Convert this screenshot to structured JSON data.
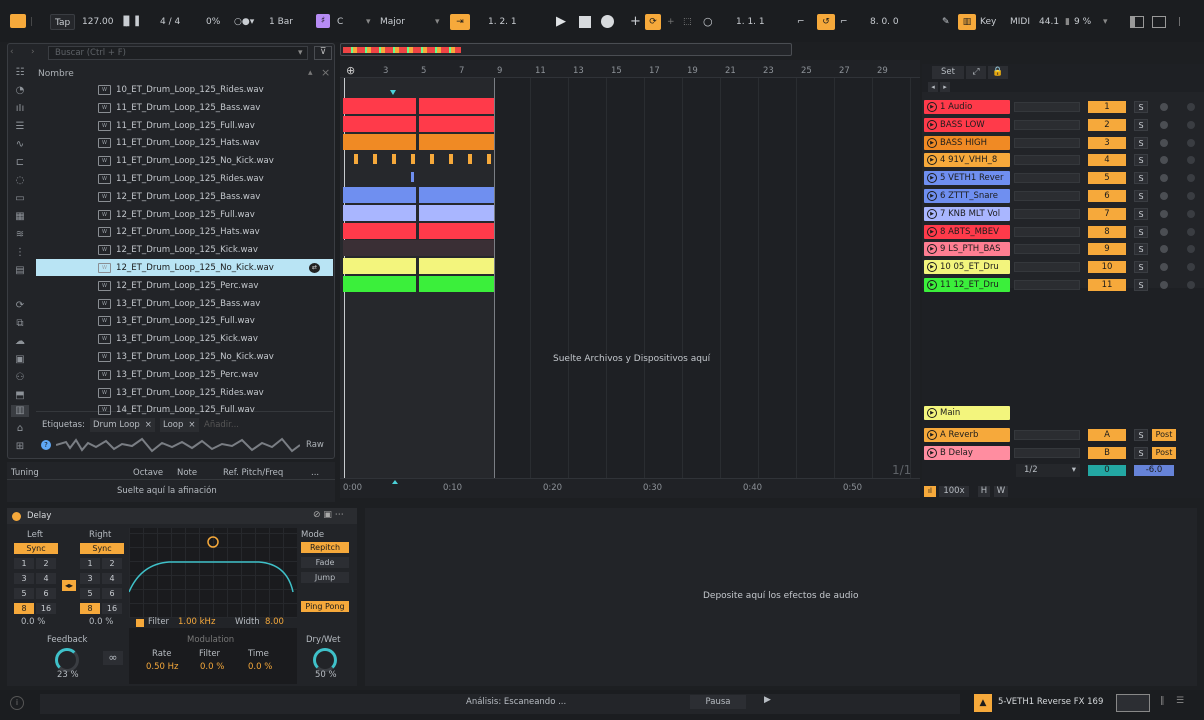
{
  "toolbar": {
    "tap": "Tap",
    "tempo": "127.00",
    "signature": "4 / 4",
    "swing": "0%",
    "quantize": "1 Bar",
    "key_letter": "C",
    "scale": "Major",
    "position": "1.   2.   1",
    "loop_start": "1.   1.   1",
    "loop_len": "8.   0.   0",
    "key_label": "Key",
    "midi_label": "MIDI",
    "sample_rate": "44.1",
    "cpu": "9 %"
  },
  "browser": {
    "search_placeholder": "Buscar (Ctrl + F)",
    "column_header": "Nombre",
    "files": [
      "10_ET_Drum_Loop_125_Rides.wav",
      "11_ET_Drum_Loop_125_Bass.wav",
      "11_ET_Drum_Loop_125_Full.wav",
      "11_ET_Drum_Loop_125_Hats.wav",
      "11_ET_Drum_Loop_125_No_Kick.wav",
      "11_ET_Drum_Loop_125_Rides.wav",
      "12_ET_Drum_Loop_125_Bass.wav",
      "12_ET_Drum_Loop_125_Full.wav",
      "12_ET_Drum_Loop_125_Hats.wav",
      "12_ET_Drum_Loop_125_Kick.wav",
      "12_ET_Drum_Loop_125_No_Kick.wav",
      "12_ET_Drum_Loop_125_Perc.wav",
      "13_ET_Drum_Loop_125_Bass.wav",
      "13_ET_Drum_Loop_125_Full.wav",
      "13_ET_Drum_Loop_125_Kick.wav",
      "13_ET_Drum_Loop_125_No_Kick.wav",
      "13_ET_Drum_Loop_125_Perc.wav",
      "13_ET_Drum_Loop_125_Rides.wav",
      "14_ET_Drum_Loop_125_Full.wav"
    ],
    "selected_index": 10,
    "tags_label": "Etiquetas:",
    "tags": [
      "Drum Loop",
      "Loop"
    ],
    "tag_add": "Añadir...",
    "raw": "Raw"
  },
  "tuning": {
    "title": "Tuning",
    "octave": "Octave",
    "note": "Note",
    "ref": "Ref. Pitch/Freq",
    "more": "...",
    "drop": "Suelte aquí la afinación"
  },
  "arrangement": {
    "ruler": [
      "3",
      "5",
      "7",
      "9",
      "11",
      "13",
      "15",
      "17",
      "19",
      "21",
      "23",
      "25",
      "27",
      "29"
    ],
    "drop_text": "Suelte Archivos y Dispositivos aquí",
    "time_ruler": [
      "0:00",
      "0:10",
      "0:20",
      "0:30",
      "0:40",
      "0:50"
    ],
    "page": "1/1"
  },
  "mixer": {
    "set": "Set",
    "tracks": [
      {
        "name": "1 Audio",
        "num": "1",
        "color": "#ff3a4a"
      },
      {
        "name": "BASS LOW",
        "num": "2",
        "color": "#ff3a4a"
      },
      {
        "name": "BASS HIGH",
        "num": "3",
        "color": "#f08a24"
      },
      {
        "name": "4 91V_VHH_8",
        "num": "4",
        "color": "#f6a93b"
      },
      {
        "name": "5 VETH1 Rever",
        "num": "5",
        "color": "#6f8ff0"
      },
      {
        "name": "6 ZTTT_Snare",
        "num": "6",
        "color": "#6f8ff0"
      },
      {
        "name": "7 KNB MLT Vol",
        "num": "7",
        "color": "#a9b6ff"
      },
      {
        "name": "8 ABTS_MBEV",
        "num": "8",
        "color": "#ff3a4a"
      },
      {
        "name": "9 LS_PTH_BAS",
        "num": "9",
        "color": "#ff7e92"
      },
      {
        "name": "10 05_ET_Dru",
        "num": "10",
        "color": "#f3f57d"
      },
      {
        "name": "11 12_ET_Dru",
        "num": "11",
        "color": "#3bef3b"
      }
    ],
    "returns": [
      {
        "name": "A Reverb",
        "num": "A",
        "color": "#f6a93b"
      },
      {
        "name": "B Delay",
        "num": "B",
        "color": "#ff8da0"
      }
    ],
    "main": "Main",
    "main_select": "1/2",
    "main_num": "0",
    "main_vol": "-6.0",
    "post": "Post",
    "s": "S",
    "zoom": "100x",
    "h": "H",
    "w": "W"
  },
  "delay": {
    "title": "Delay",
    "left": "Left",
    "right": "Right",
    "sync": "Sync",
    "grid": [
      "1",
      "2",
      "3",
      "4",
      "5",
      "6",
      "8",
      "16"
    ],
    "left_pct": "0.0 %",
    "right_pct": "0.0 %",
    "mode": "Mode",
    "modes": [
      "Repitch",
      "Fade",
      "Jump"
    ],
    "ping_pong": "Ping Pong",
    "filter_label": "Filter",
    "filter_val": "1.00 kHz",
    "width_label": "Width",
    "width_val": "8.00",
    "feedback": "Feedback",
    "feedback_val": "23 %",
    "modulation": "Modulation",
    "rate": "Rate",
    "rate_val": "0.50 Hz",
    "mfilter": "Filter",
    "mfilter_val": "0.0 %",
    "time": "Time",
    "time_val": "0.0 %",
    "drywet": "Dry/Wet",
    "drywet_val": "50 %"
  },
  "device_drop": "Deposite aquí los efectos de audio",
  "status": {
    "analysis": "Análisis: Escaneando ...",
    "pause": "Pausa",
    "current": "5-VETH1 Reverse FX 169"
  }
}
